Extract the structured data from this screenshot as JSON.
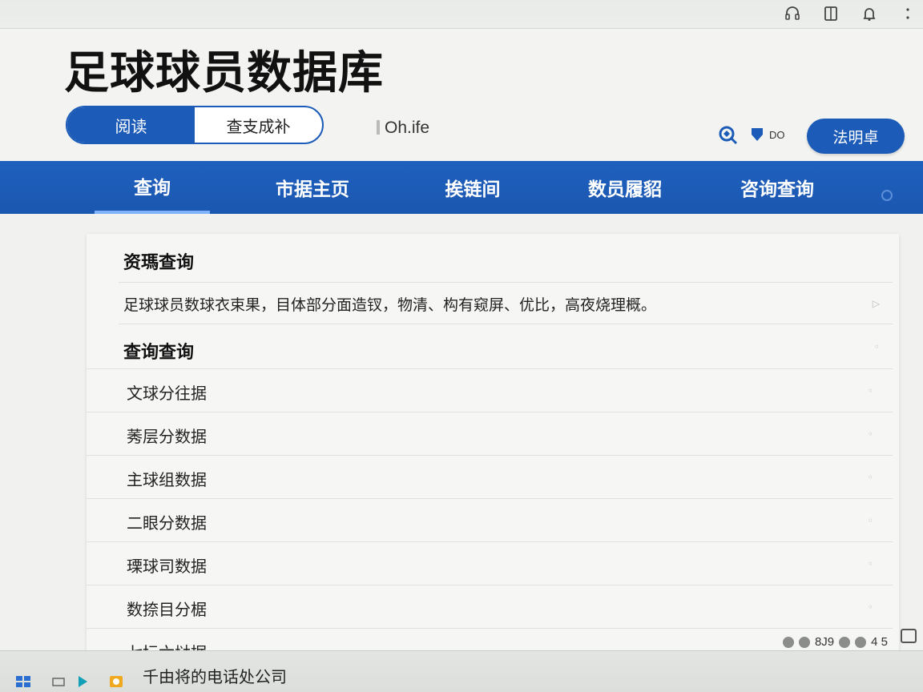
{
  "app": {
    "title": "足球球员数据库",
    "segmented": {
      "options": [
        "阅读",
        "查支成补"
      ],
      "active_index": 0
    },
    "small_text": "Oh.ife",
    "header_badge_text": "DO",
    "action_button": "法明卓"
  },
  "top_icons": [
    "headset-icon",
    "book-icon",
    "bell-icon",
    "more-icon"
  ],
  "nav": {
    "items": [
      "查询",
      "市据主页",
      "挨链间",
      "数员履貂",
      "咨询查询"
    ],
    "active_index": 0
  },
  "content": {
    "section1_title": "资瑪查询",
    "description": "足球球员数球衣束果，目体部分面造钗，物清、构有窥屏、优比，高夜烧理概。",
    "section2_title": "查询查询",
    "rows": [
      "文球分往据",
      "莠层分数据",
      "主球组数据",
      "二眼分数据",
      "瑮球司数据",
      "数捺目分椐",
      "七坛六垯据"
    ]
  },
  "taskbar": {
    "app_text": "千由将的电话处公司",
    "tray_text": "8J9",
    "tray_number": "4 5"
  },
  "colors": {
    "accent": "#1c5bb7",
    "nav_bg": "#1f60be",
    "background": "#f1f2ef"
  }
}
